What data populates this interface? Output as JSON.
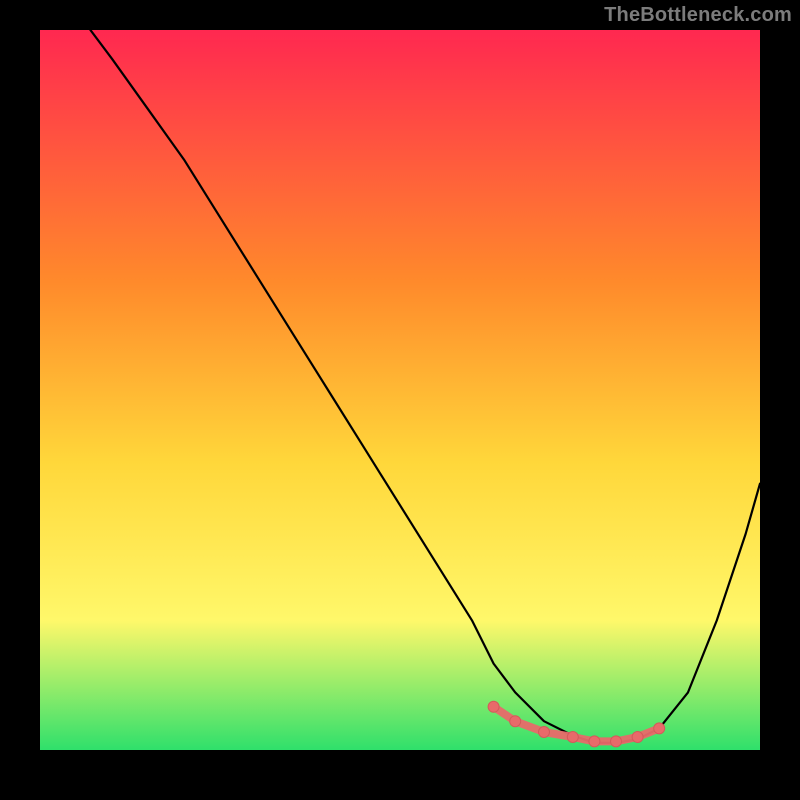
{
  "watermark": "TheBottleneck.com",
  "colors": {
    "bg_black": "#000000",
    "grad_top": "#ff2850",
    "grad_mid1": "#ff8a2b",
    "grad_mid2": "#ffd73a",
    "grad_mid3": "#fff86a",
    "grad_bottom": "#2fe06b",
    "curve": "#000000",
    "marker_fill": "#e86a6a",
    "marker_stroke": "#d45a5a"
  },
  "chart_data": {
    "type": "line",
    "title": "",
    "xlabel": "",
    "ylabel": "",
    "x_range": [
      0,
      100
    ],
    "y_range": [
      0,
      100
    ],
    "series": [
      {
        "name": "curve",
        "x": [
          7,
          10,
          15,
          20,
          25,
          30,
          35,
          40,
          45,
          50,
          55,
          60,
          63,
          66,
          70,
          74,
          77,
          80,
          83,
          86,
          90,
          94,
          98,
          100
        ],
        "y": [
          100,
          96,
          89,
          82,
          74,
          66,
          58,
          50,
          42,
          34,
          26,
          18,
          12,
          8,
          4,
          2,
          1,
          1,
          1.5,
          3,
          8,
          18,
          30,
          37
        ]
      }
    ],
    "markers": {
      "name": "optimal-band",
      "x": [
        63,
        66,
        70,
        74,
        77,
        80,
        83,
        86
      ],
      "y": [
        6,
        4,
        2.5,
        1.8,
        1.2,
        1.2,
        1.8,
        3
      ]
    }
  }
}
